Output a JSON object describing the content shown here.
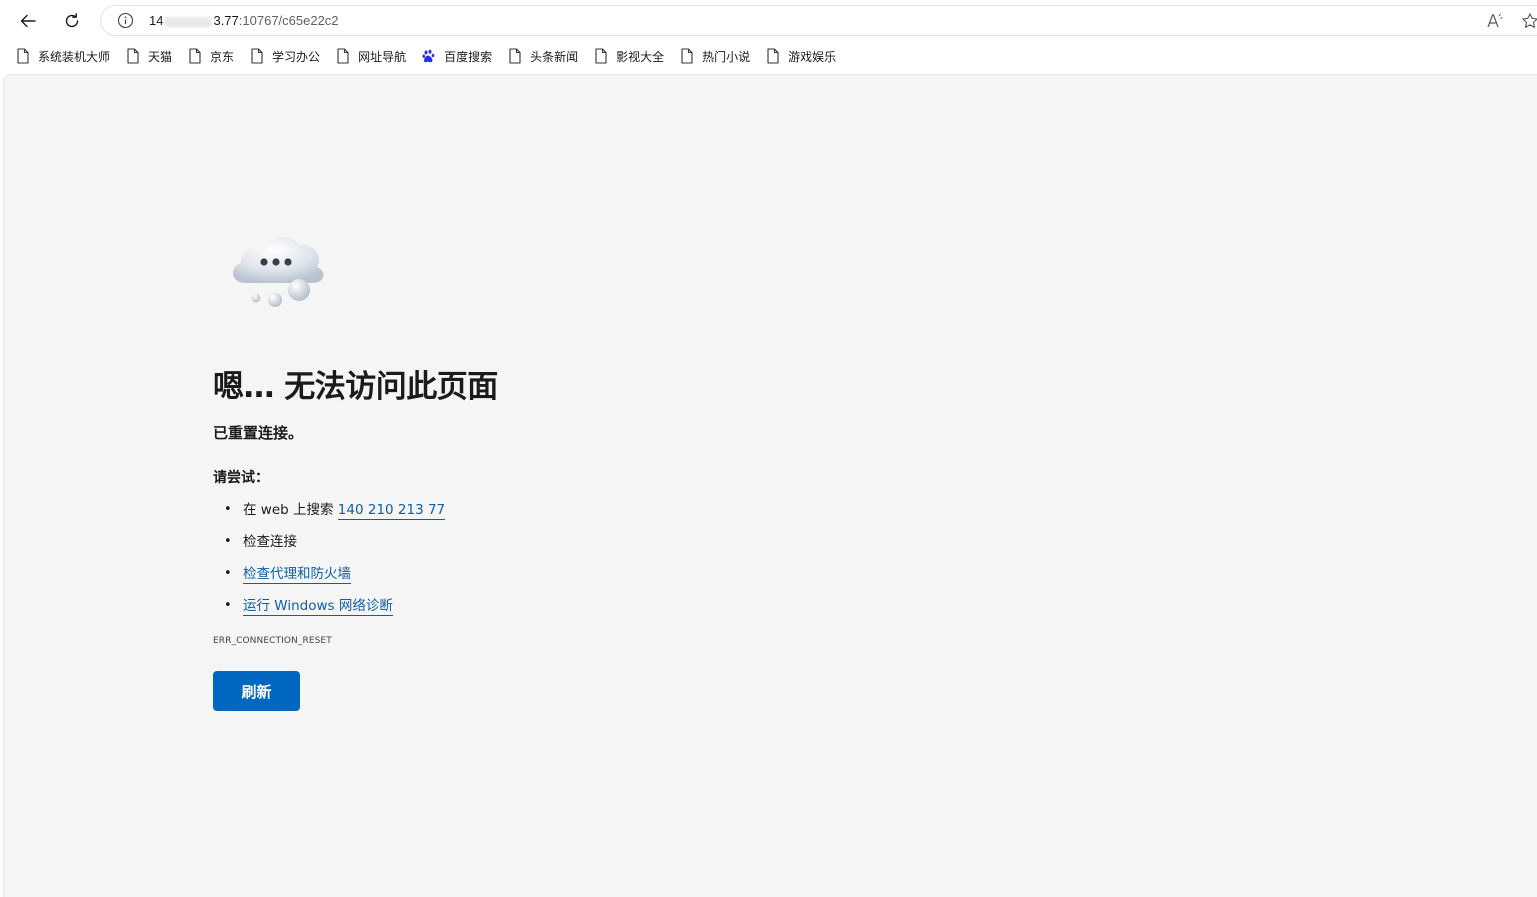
{
  "browser": {
    "address": {
      "host_visible_start": "14",
      "host_visible_end": "3.77",
      "path": ":10767/c65e22c2"
    },
    "icons": {
      "back": "back-arrow-icon",
      "refresh": "refresh-icon",
      "info": "info-icon",
      "read_aloud": "read-aloud-icon",
      "favorite": "star-icon"
    }
  },
  "bookmarks": [
    {
      "label": "系统装机大师",
      "icon": "page-icon"
    },
    {
      "label": "天猫",
      "icon": "page-icon"
    },
    {
      "label": "京东",
      "icon": "page-icon"
    },
    {
      "label": "学习办公",
      "icon": "page-icon"
    },
    {
      "label": "网址导航",
      "icon": "page-icon"
    },
    {
      "label": "百度搜索",
      "icon": "baidu-paw-icon"
    },
    {
      "label": "头条新闻",
      "icon": "page-icon"
    },
    {
      "label": "影视大全",
      "icon": "page-icon"
    },
    {
      "label": "热门小说",
      "icon": "page-icon"
    },
    {
      "label": "游戏娱乐",
      "icon": "page-icon"
    }
  ],
  "error": {
    "title": "嗯… 无法访问此页面",
    "subtitle": "已重置连接。",
    "try_label": "请尝试：",
    "suggestions": {
      "search_prefix": "在 web 上搜索 ",
      "search_link": "140 210 213 77",
      "check_connection": "检查连接",
      "check_proxy": "检查代理和防火墙",
      "run_diagnostics": "运行 Windows 网络诊断"
    },
    "code": "ERR_CONNECTION_RESET",
    "refresh_label": "刷新"
  },
  "colors": {
    "accent": "#0067c0",
    "link": "#0f5ea8",
    "page_bg": "#f5f5f5"
  }
}
